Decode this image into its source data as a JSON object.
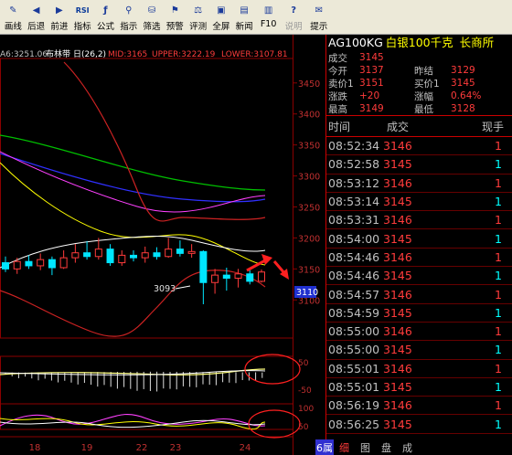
{
  "toolbar": {
    "buttons": [
      {
        "label": "画线",
        "icon": "draw-line-icon",
        "glyph": "✎"
      },
      {
        "label": "后退",
        "icon": "back-icon",
        "glyph": "◀"
      },
      {
        "label": "前进",
        "icon": "forward-icon",
        "glyph": "▶"
      },
      {
        "label": "指标",
        "icon": "rsi-indicator-icon",
        "glyph": "RSI"
      },
      {
        "label": "公式",
        "icon": "formula-icon",
        "glyph": "ƒ"
      },
      {
        "label": "指示",
        "icon": "indicator-icon",
        "glyph": "⚲"
      },
      {
        "label": "筛选",
        "icon": "filter-icon",
        "glyph": "⛁"
      },
      {
        "label": "预警",
        "icon": "alert-icon",
        "glyph": "⚑"
      },
      {
        "label": "评测",
        "icon": "evaluate-icon",
        "glyph": "⚖"
      },
      {
        "label": "全屏",
        "icon": "fullscreen-icon",
        "glyph": "▣"
      },
      {
        "label": "新闻",
        "icon": "news-icon",
        "glyph": "▤"
      },
      {
        "label": "F10",
        "icon": "f10-icon",
        "glyph": "▥"
      },
      {
        "label": "说明",
        "icon": "help-icon",
        "glyph": "?"
      },
      {
        "label": "提示",
        "icon": "tips-icon",
        "glyph": "✉"
      }
    ]
  },
  "chart": {
    "header": {
      "ma_text": "A6:3251.06",
      "name": "布林带",
      "period": "日(26,2)",
      "mid": "MID:3165",
      "upper": "UPPER:3222.19",
      "lower": "LOWER:3107.81"
    },
    "price_ticks": [
      "3450",
      "3400",
      "3350",
      "3300",
      "3250",
      "3200",
      "3150",
      "3100"
    ],
    "current_price_label": "3110",
    "low_annotation": "3093",
    "macd_ticks": [
      "50",
      "-50"
    ],
    "kdj_ticks": [
      "100",
      "50"
    ],
    "x_labels": [
      "18",
      "19",
      "22",
      "23",
      "24"
    ],
    "colors": {
      "up": "#ff3b3b",
      "down": "#00e5ff",
      "grid": "#8b0000",
      "mid": "#ffffff",
      "upper": "#cc2222",
      "lower": "#cc2222"
    }
  },
  "chart_data": {
    "type": "candlestick",
    "title": "AG100KG 白银100千克",
    "indicator": "布林带 日(26,2)",
    "ylim": [
      3093,
      3460
    ],
    "x_labels": [
      "18",
      "19",
      "22",
      "23",
      "24"
    ],
    "bollinger": {
      "mid": 3165,
      "upper": 3222.19,
      "lower": 3107.81
    },
    "candles": [
      {
        "o": 3160,
        "c": 3150,
        "h": 3170,
        "l": 3145,
        "up": false
      },
      {
        "o": 3150,
        "c": 3162,
        "h": 3168,
        "l": 3142,
        "up": true
      },
      {
        "o": 3162,
        "c": 3155,
        "h": 3172,
        "l": 3150,
        "up": false
      },
      {
        "o": 3155,
        "c": 3165,
        "h": 3175,
        "l": 3148,
        "up": true
      },
      {
        "o": 3165,
        "c": 3152,
        "h": 3170,
        "l": 3140,
        "up": false
      },
      {
        "o": 3152,
        "c": 3168,
        "h": 3180,
        "l": 3150,
        "up": true
      },
      {
        "o": 3168,
        "c": 3176,
        "h": 3190,
        "l": 3160,
        "up": true
      },
      {
        "o": 3176,
        "c": 3170,
        "h": 3195,
        "l": 3165,
        "up": false
      },
      {
        "o": 3170,
        "c": 3182,
        "h": 3200,
        "l": 3165,
        "up": true
      },
      {
        "o": 3182,
        "c": 3160,
        "h": 3190,
        "l": 3155,
        "up": false
      },
      {
        "o": 3160,
        "c": 3172,
        "h": 3180,
        "l": 3155,
        "up": true
      },
      {
        "o": 3172,
        "c": 3168,
        "h": 3180,
        "l": 3162,
        "up": false
      },
      {
        "o": 3168,
        "c": 3176,
        "h": 3186,
        "l": 3160,
        "up": true
      },
      {
        "o": 3176,
        "c": 3170,
        "h": 3185,
        "l": 3165,
        "up": false
      },
      {
        "o": 3170,
        "c": 3182,
        "h": 3200,
        "l": 3168,
        "up": true
      },
      {
        "o": 3182,
        "c": 3175,
        "h": 3196,
        "l": 3170,
        "up": false
      },
      {
        "o": 3175,
        "c": 3178,
        "h": 3190,
        "l": 3168,
        "up": true
      },
      {
        "o": 3178,
        "c": 3128,
        "h": 3180,
        "l": 3093,
        "up": false
      },
      {
        "o": 3128,
        "c": 3140,
        "h": 3150,
        "l": 3110,
        "up": true
      },
      {
        "o": 3140,
        "c": 3135,
        "h": 3152,
        "l": 3115,
        "up": false
      },
      {
        "o": 3135,
        "c": 3142,
        "h": 3150,
        "l": 3120,
        "up": true
      },
      {
        "o": 3142,
        "c": 3130,
        "h": 3148,
        "l": 3125,
        "up": false
      },
      {
        "o": 3130,
        "c": 3145,
        "h": 3149,
        "l": 3128,
        "up": true
      }
    ]
  },
  "quote": {
    "code": "AG100KG",
    "name": "白银100千克",
    "exchange": "长商所",
    "rows": [
      {
        "k1": "成交",
        "v1": "3145",
        "k2": "",
        "v2": ""
      },
      {
        "k1": "今开",
        "v1": "3137",
        "k2": "昨结",
        "v2": "3129"
      },
      {
        "k1": "卖价1",
        "v1": "3151",
        "k2": "买价1",
        "v2": "3145"
      },
      {
        "k1": "涨跌",
        "v1": "+20",
        "k2": "涨幅",
        "v2": "0.64%"
      },
      {
        "k1": "最高",
        "v1": "3149",
        "k2": "最低",
        "v2": "3128"
      }
    ]
  },
  "ticks": {
    "headers": {
      "time": "时间",
      "price": "成交",
      "vol": "现手"
    },
    "rows": [
      {
        "time": "08:52:34",
        "price": "3146",
        "vol": "1",
        "color": "red"
      },
      {
        "time": "08:52:58",
        "price": "3145",
        "vol": "1",
        "color": "cy"
      },
      {
        "time": "08:53:12",
        "price": "3146",
        "vol": "1",
        "color": "red"
      },
      {
        "time": "08:53:14",
        "price": "3145",
        "vol": "1",
        "color": "cy"
      },
      {
        "time": "08:53:31",
        "price": "3146",
        "vol": "1",
        "color": "red"
      },
      {
        "time": "08:54:00",
        "price": "3145",
        "vol": "1",
        "color": "cy"
      },
      {
        "time": "08:54:46",
        "price": "3146",
        "vol": "1",
        "color": "red"
      },
      {
        "time": "08:54:46",
        "price": "3145",
        "vol": "1",
        "color": "cy"
      },
      {
        "time": "08:54:57",
        "price": "3146",
        "vol": "1",
        "color": "red"
      },
      {
        "time": "08:54:59",
        "price": "3145",
        "vol": "1",
        "color": "cy"
      },
      {
        "time": "08:55:00",
        "price": "3146",
        "vol": "1",
        "color": "red"
      },
      {
        "time": "08:55:00",
        "price": "3145",
        "vol": "1",
        "color": "cy"
      },
      {
        "time": "08:55:01",
        "price": "3146",
        "vol": "1",
        "color": "red"
      },
      {
        "time": "08:55:01",
        "price": "3145",
        "vol": "1",
        "color": "cy"
      },
      {
        "time": "08:56:19",
        "price": "3146",
        "vol": "1",
        "color": "red"
      },
      {
        "time": "08:56:25",
        "price": "3145",
        "vol": "1",
        "color": "cy"
      }
    ]
  },
  "bottom_tabs": [
    "6属",
    "细",
    "图",
    "盘",
    "成"
  ]
}
